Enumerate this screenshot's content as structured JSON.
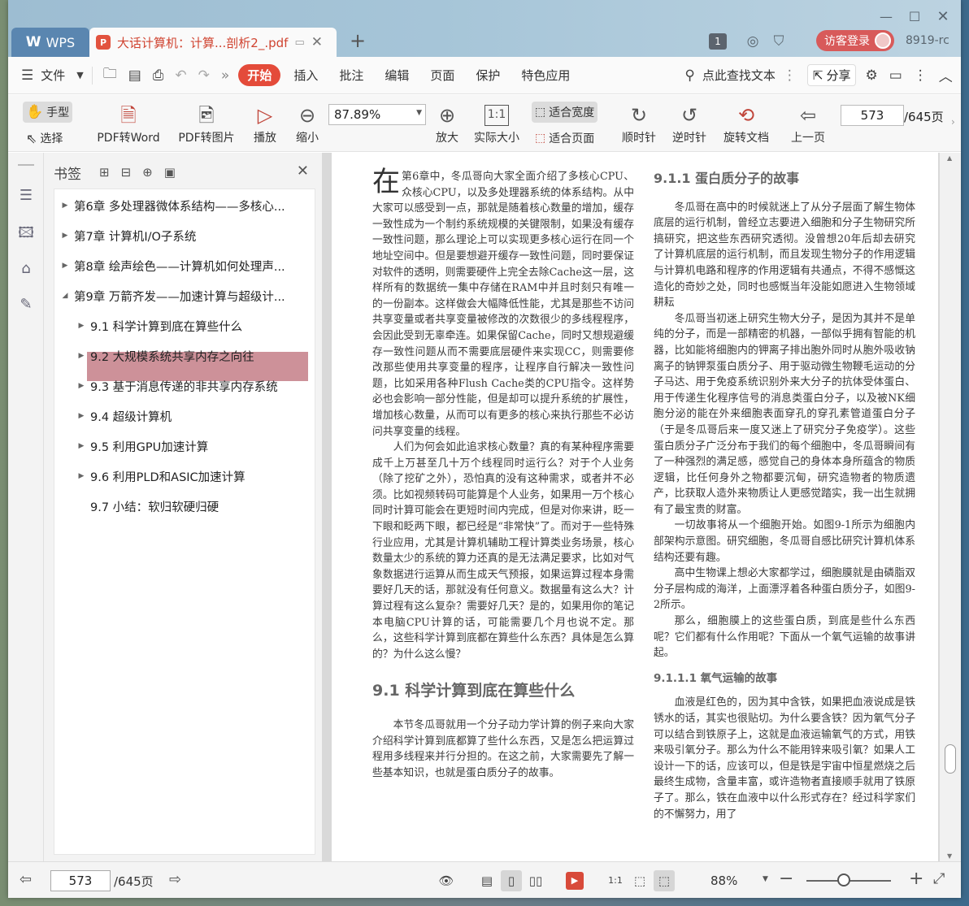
{
  "titlebar": {
    "app_tab": "WPS",
    "doc_tab": "大话计算机：计算...剖析2_.pdf",
    "page_badge": "1",
    "guest_login": "访客登录",
    "version": "8919-rc"
  },
  "menubar": {
    "file": "文件",
    "tabs": [
      "开始",
      "插入",
      "批注",
      "编辑",
      "页面",
      "保护",
      "特色应用"
    ],
    "active_tab": "开始",
    "search": "点此查找文本",
    "share": "分享"
  },
  "toolbar": {
    "hand": "手型",
    "select": "选择",
    "pdf_to_word": "PDF转Word",
    "pdf_to_image": "PDF转图片",
    "play": "播放",
    "zoom_out": "缩小",
    "zoom_value": "87.89%",
    "zoom_in": "放大",
    "actual_size": "实际大小",
    "fit_width": "适合宽度",
    "fit_page": "适合页面",
    "clockwise": "顺时针",
    "counterclockwise": "逆时针",
    "rotate_doc": "旋转文档",
    "prev_page": "上一页",
    "current_page": "573",
    "total_pages": "/645页"
  },
  "bookmarks": {
    "title": "书签",
    "items": [
      {
        "label": "第6章  多处理器微体系结构——多核心...",
        "level": 1,
        "arrow": "▶"
      },
      {
        "label": "第7章  计算机I/O子系统",
        "level": 1,
        "arrow": "▶"
      },
      {
        "label": "第8章  绘声绘色——计算机如何处理声...",
        "level": 1,
        "arrow": "▶"
      },
      {
        "label": "第9章  万箭齐发——加速计算与超级计...",
        "level": 1,
        "arrow": "◢"
      },
      {
        "label": "9.1  科学计算到底在算些什么",
        "level": 2,
        "arrow": "▶",
        "selected": true
      },
      {
        "label": "9.2  大规模系统共享内存之向往",
        "level": 2,
        "arrow": "▶"
      },
      {
        "label": "9.3  基于消息传递的非共享内存系统",
        "level": 2,
        "arrow": "▶"
      },
      {
        "label": "9.4  超级计算机",
        "level": 2,
        "arrow": "▶"
      },
      {
        "label": "9.5  利用GPU加速计算",
        "level": 2,
        "arrow": "▶"
      },
      {
        "label": "9.6  利用PLD和ASIC加速计算",
        "level": 2,
        "arrow": "▶"
      },
      {
        "label": "9.7  小结：软归软硬归硬",
        "level": 2,
        "arrow": ""
      }
    ]
  },
  "document": {
    "left": {
      "dropcap": "在",
      "p1": "第6章中，冬瓜哥向大家全面介绍了多核心CPU、众核心CPU，以及多处理器系统的体系结构。从中大家可以感受到一点，那就是随着核心数量的增加，缓存一致性成为一个制约系统规模的关键限制，如果没有缓存一致性问题，那么理论上可以实现更多核心运行在同一个地址空间中。但是要想避开缓存一致性问题，同时要保证对软件的透明，则需要硬件上完全去除Cache这一层，这样所有的数据统一集中存储在RAM中并且时刻只有唯一的一份副本。这样做会大幅降低性能，尤其是那些不访问共享变量或者共享变量被修改的次数很少的多线程程序，会因此受到无辜牵连。如果保留Cache，同时又想规避缓存一致性问题从而不需要底层硬件来实现CC，则需要修改那些使用共享变量的程序，让程序自行解决一致性问题，比如采用各种Flush Cache类的CPU指令。这样势必也会影响一部分性能，但是却可以提升系统的扩展性，增加核心数量，从而可以有更多的核心来执行那些不必访问共享变量的线程。",
      "p2": "人们为何会如此追求核心数量？真的有某种程序需要成千上万甚至几十万个线程同时运行么？对于个人业务（除了挖矿之外），恐怕真的没有这种需求，或者并不必须。比如视频转码可能算是个人业务，如果用一万个核心同时计算可能会在更短时间内完成，但是对你来讲，眨一下眼和眨两下眼，都已经是“非常快”了。而对于一些特殊行业应用，尤其是计算机辅助工程计算类业务场景，核心数量太少的系统的算力还真的是无法满足要求，比如对气象数据进行运算从而生成天气预报，如果运算过程本身需要好几天的话，那就没有任何意义。数据量有这么大？计算过程有这么复杂？需要好几天？是的，如果用你的笔记本电脑CPU计算的话，可能需要几个月也说不定。那么，这些科学计算到底都在算些什么东西？具体是怎么算的？为什么这么慢？",
      "h2": "9.1   科学计算到底在算些什么",
      "p3": "本节冬瓜哥就用一个分子动力学计算的例子来向大家介绍科学计算到底都算了些什么东西，又是怎么把运算过程用多线程来并行分担的。在这之前，大家需要先了解一些基本知识，也就是蛋白质分子的故事。"
    },
    "right": {
      "h3": "9.1.1   蛋白质分子的故事",
      "p1": "冬瓜哥在高中的时候就迷上了从分子层面了解生物体底层的运行机制，曾经立志要进入细胞和分子生物研究所搞研究，把这些东西研究透彻。没曾想20年后却去研究了计算机底层的运行机制，而且发现生物分子的作用逻辑与计算机电路和程序的作用逻辑有共通点，不得不感慨这造化的奇妙之处，同时也感慨当年没能如愿进入生物领域耕耘",
      "p2": "冬瓜哥当初迷上研究生物大分子，是因为其并不是单纯的分子，而是一部精密的机器，一部似乎拥有智能的机器，比如能将细胞内的钾离子排出胞外同时从胞外吸收钠离子的钠钾泵蛋白质分子、用于驱动微生物鞭毛运动的分子马达、用于免疫系统识别外来大分子的抗体受体蛋白、用于传递生化程序信号的消息类蛋白分子，以及被NK细胞分泌的能在外来细胞表面穿孔的穿孔素管道蛋白分子（于是冬瓜哥后来一度又迷上了研究分子免疫学）。这些蛋白质分子广泛分布于我们的每个细胞中，冬瓜哥瞬间有了一种强烈的满足感，感觉自己的身体本身所蕴含的物质逻辑，比任何身外之物都要沉甸，研究造物者的物质遗产，比获取人造外来物质让人更感觉踏实，我一出生就拥有了最宝贵的财富。",
      "p3": "一切故事将从一个细胞开始。如图9-1所示为细胞内部架构示意图。研究细胞，冬瓜哥自感比研究计算机体系结构还要有趣。",
      "p4": "高中生物课上想必大家都学过，细胞膜就是由磷脂双分子层构成的海洋，上面漂浮着各种蛋白质分子，如图9-2所示。",
      "p5": "那么，细胞膜上的这些蛋白质，到底是些什么东西呢？它们都有什么作用呢？下面从一个氧气运输的故事讲起。",
      "h4": "9.1.1.1   氧气运输的故事",
      "p6": "血液是红色的，因为其中含铁，如果把血液说成是铁锈水的话，其实也很贴切。为什么要含铁？因为氧气分子可以结合到铁原子上，这就是血液运输氧气的方式，用铁来吸引氧分子。那么为什么不能用锌来吸引氧？如果人工设计一下的话，应该可以，但是铁是宇宙中恒星燃烧之后最终生成物，含量丰富，或许造物者直接顺手就用了铁原子了。那么，铁在血液中以什么形式存在？经过科学家们的不懈努力，用了"
    }
  },
  "statusbar": {
    "current_page": "573",
    "total_pages": "/645页",
    "zoom": "88%"
  }
}
